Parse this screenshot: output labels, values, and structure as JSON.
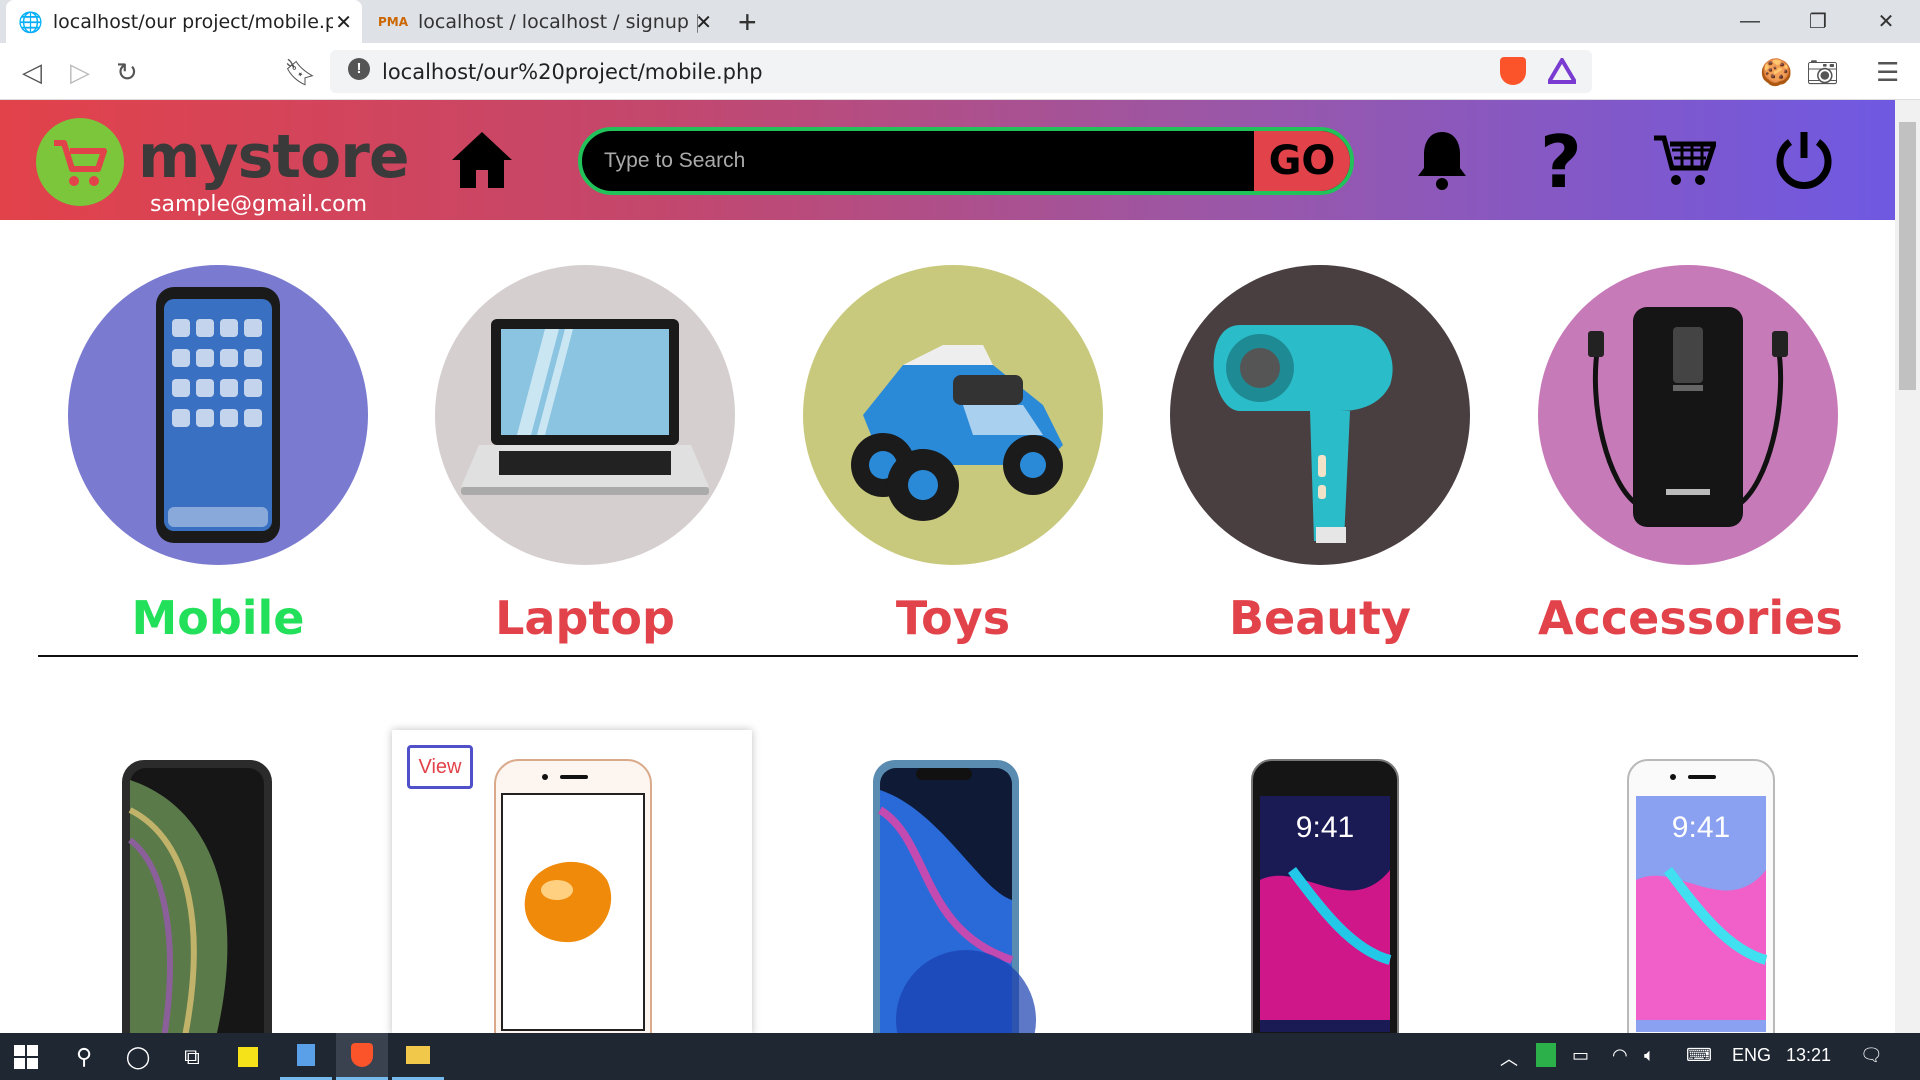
{
  "browser": {
    "tabs": [
      {
        "title": "localhost/our project/mobile.php",
        "active": true
      },
      {
        "title": "localhost / localhost / signup | php",
        "active": false
      }
    ],
    "url": "localhost/our%20project/mobile.php"
  },
  "header": {
    "brand": "mystore",
    "email": "sample@gmail.com",
    "search_placeholder": "Type to Search",
    "go_label": "GO"
  },
  "categories": [
    {
      "label": "Mobile",
      "color": "#22e05a",
      "bg": "#7a7ad0"
    },
    {
      "label": "Laptop",
      "color": "#e2424a",
      "bg": "#d6cfcf"
    },
    {
      "label": "Toys",
      "color": "#e2424a",
      "bg": "#c9c97e"
    },
    {
      "label": "Beauty",
      "color": "#e2424a",
      "bg": "#4a3f40"
    },
    {
      "label": "Accessories",
      "color": "#e2424a",
      "bg": "#c77ab8"
    }
  ],
  "products": {
    "view_label": "View"
  },
  "taskbar": {
    "lang": "ENG",
    "time": "13:21"
  },
  "colors": {
    "accent_red": "#e2424a",
    "accent_green": "#22c25a",
    "header_gradient_end": "#6f59e2"
  }
}
